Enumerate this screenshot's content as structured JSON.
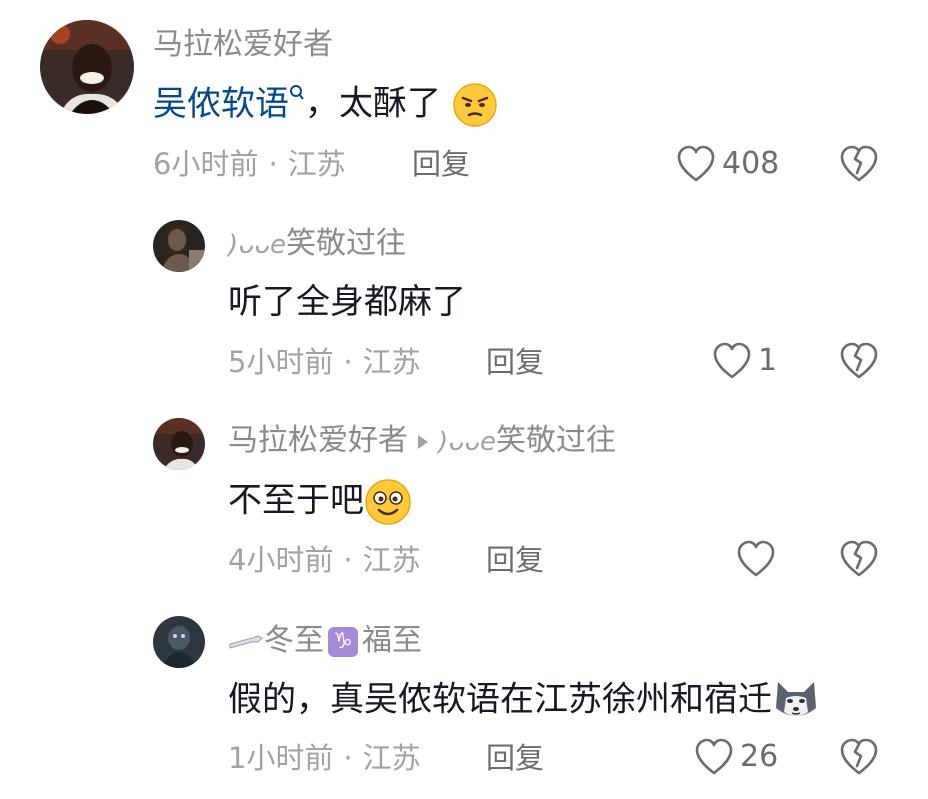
{
  "comments": [
    {
      "author": "马拉松爱好者",
      "mention": "吴侬软语",
      "text": "，太酥了",
      "emoji": "smirk-emoji",
      "time": "6小时前",
      "location": "江苏",
      "reply_label": "回复",
      "likes": "408"
    },
    {
      "author_deco": ")ᴗᴗe",
      "author": "笑敬过往",
      "text": "听了全身都麻了",
      "time": "5小时前",
      "location": "江苏",
      "reply_label": "回复",
      "likes": "1"
    },
    {
      "author": "马拉松爱好者",
      "reply_to_deco": ")ᴗᴗe",
      "reply_to": "笑敬过往",
      "text": "不至于吧",
      "emoji": "dizzy-face-emoji",
      "time": "4小时前",
      "location": "江苏",
      "reply_label": "回复",
      "likes": ""
    },
    {
      "author_prefix": "冬至",
      "zodiac": "♑",
      "author_suffix": "福至",
      "text": "假的，真吴侬软语在江苏徐州和宿迁",
      "emoji": "husky-emoji",
      "time": "1小时前",
      "location": "江苏",
      "reply_label": "回复",
      "likes": "26"
    }
  ],
  "separator": "·",
  "colors": {
    "mention": "#04498d",
    "meta": "#a1a2a7",
    "text": "#161823"
  }
}
